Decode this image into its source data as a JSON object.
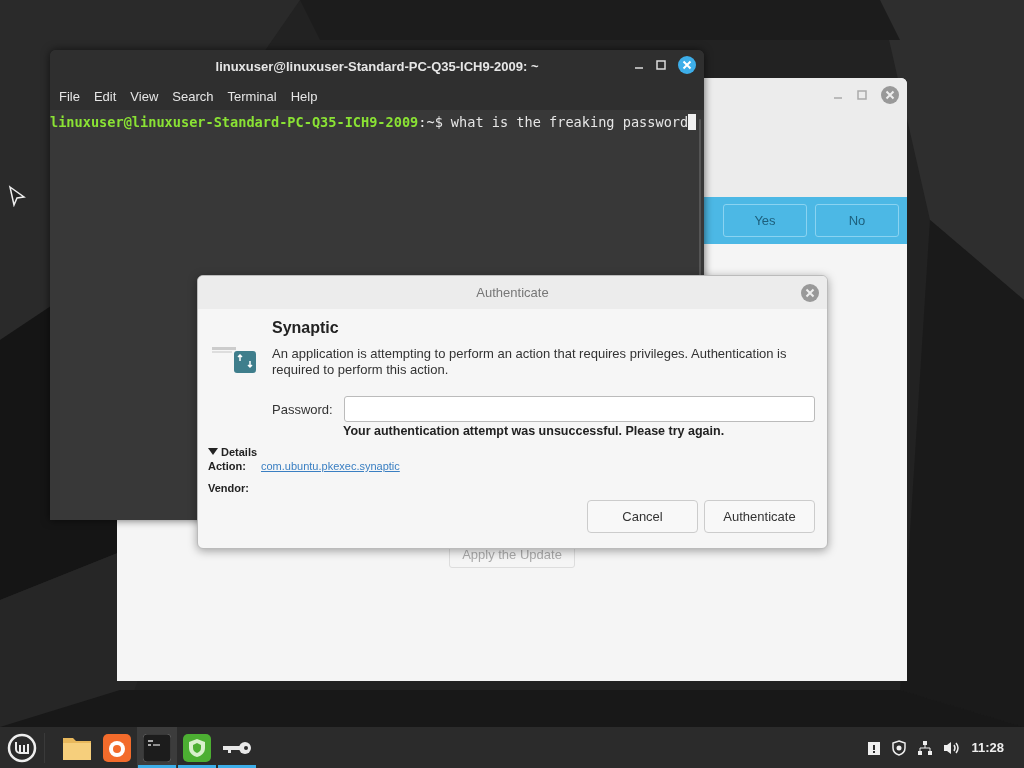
{
  "terminal": {
    "title": "linuxuser@linuxuser-Standard-PC-Q35-ICH9-2009: ~",
    "menu": [
      "File",
      "Edit",
      "View",
      "Search",
      "Terminal",
      "Help"
    ],
    "prompt_user": "linuxuser@linuxuser-Standard-PC-Q35-ICH9-2009",
    "prompt_path": ":~$",
    "command": "what is the freaking password"
  },
  "background_window": {
    "buttons": [
      "Yes",
      "No"
    ],
    "action_button": "Apply the Update"
  },
  "auth_dialog": {
    "title": "Authenticate",
    "heading": "Synaptic",
    "message": "An application is attempting to perform an action that requires privileges. Authentication is required to perform this action.",
    "password_label": "Password:",
    "error": "Your authentication attempt was unsuccessful. Please try again.",
    "details_label": "Details",
    "details_expanded": true,
    "details": [
      {
        "label": "Action:",
        "value": "com.ubuntu.pkexec.synaptic"
      },
      {
        "label": "Vendor:"
      }
    ],
    "buttons": [
      "Cancel",
      "Authenticate"
    ]
  },
  "taskbar": {
    "apps": [
      {
        "kind": "folder",
        "running": false,
        "selected": false
      },
      {
        "kind": "browser",
        "running": false,
        "selected": false
      },
      {
        "kind": "terminal",
        "running": true,
        "selected": true
      },
      {
        "kind": "shield",
        "running": true,
        "selected": false
      },
      {
        "kind": "key",
        "running": true,
        "selected": false
      }
    ],
    "clock": "11:28"
  }
}
